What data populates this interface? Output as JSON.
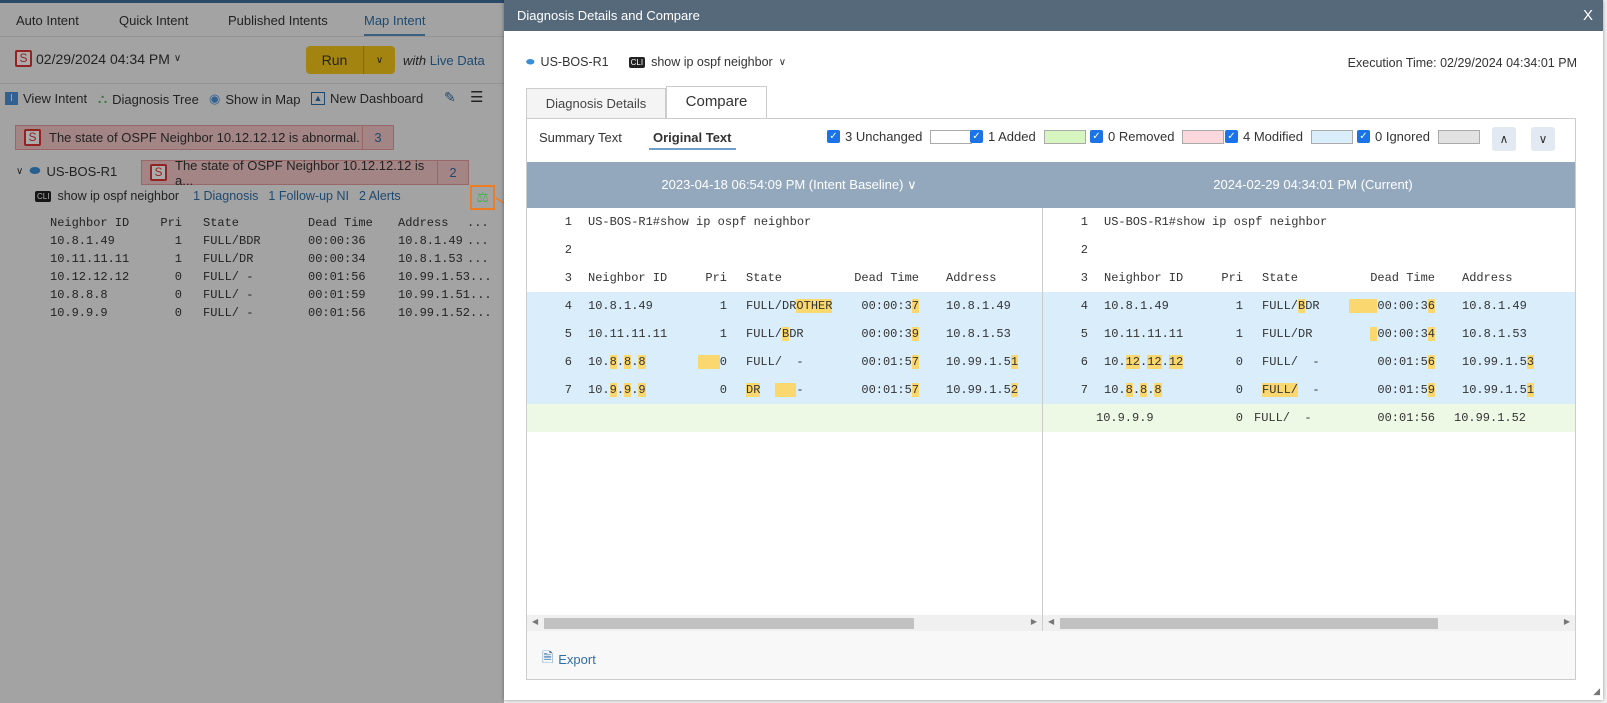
{
  "left_panel": {
    "tabs": [
      "Auto Intent",
      "Quick Intent",
      "Published Intents",
      "Map Intent"
    ],
    "active_tab": "Map Intent",
    "date": "02/29/2024 04:34 PM",
    "run_label": "Run",
    "with_label": "with",
    "live_data_label": "Live Data",
    "toolbar": [
      "View Intent",
      "Diagnosis Tree",
      "Show in Map",
      "New Dashboard"
    ],
    "alert_main": {
      "text": "The state of OSPF Neighbor 10.12.12.12 is abnormal.",
      "count": "3"
    },
    "device": "US-BOS-R1",
    "alert_device": {
      "text": "The state of OSPF Neighbor 10.12.12.12 is a...",
      "count": "2"
    },
    "cli_badge": "CLI",
    "command": "show ip ospf neighbor",
    "links": [
      "1 Diagnosis",
      "1 Follow-up NI",
      "2 Alerts"
    ],
    "table": {
      "headers": [
        "Neighbor ID",
        "Pri",
        "State",
        "Dead Time",
        "Address",
        "..."
      ],
      "rows": [
        [
          "10.8.1.49",
          "1",
          "FULL/BDR",
          "00:00:36",
          "10.8.1.49",
          "..."
        ],
        [
          "10.11.11.11",
          "1",
          "FULL/DR",
          "00:00:34",
          "10.8.1.53",
          "..."
        ],
        [
          "10.12.12.12",
          "0",
          "FULL/  -",
          "00:01:56",
          "10.99.1.53...",
          ""
        ],
        [
          "10.8.8.8",
          "0",
          "FULL/  -",
          "00:01:59",
          "10.99.1.51...",
          ""
        ],
        [
          "10.9.9.9",
          "0",
          "FULL/  -",
          "00:01:56",
          "10.99.1.52...",
          ""
        ]
      ]
    }
  },
  "modal": {
    "title": "Diagnosis Details and Compare",
    "close": "X",
    "device": "US-BOS-R1",
    "cli_badge": "CLI",
    "command": "show ip ospf neighbor",
    "execution_time": "Execution Time: 02/29/2024 04:34:01 PM",
    "tabs": [
      "Diagnosis Details",
      "Compare"
    ],
    "active_tab": "Compare",
    "view_modes": [
      "Summary Text",
      "Original Text"
    ],
    "active_view": "Original Text",
    "filters": [
      {
        "label": "3 Unchanged",
        "checked": true,
        "color": "#ffffff"
      },
      {
        "label": "1 Added",
        "checked": true,
        "color": "#d6f5c0"
      },
      {
        "label": "0 Removed",
        "checked": true,
        "color": "#fcd7dc"
      },
      {
        "label": "4 Modified",
        "checked": true,
        "color": "#d9edfb"
      },
      {
        "label": "0 Ignored",
        "checked": true,
        "color": "#e2e2e2"
      }
    ],
    "nav_up": "∧",
    "nav_down": "∨",
    "left_header": "2023-04-18 06:54:09 PM (Intent Baseline) ∨",
    "right_header": "2024-02-29 04:34:01 PM (Current)",
    "left_lines": [
      {
        "n": "1",
        "type": "unchanged",
        "cells": [
          [
            [
              "US-BOS-R1#show ip ospf neighbor",
              0
            ]
          ]
        ]
      },
      {
        "n": "2",
        "type": "unchanged",
        "cells": []
      },
      {
        "n": "3",
        "type": "unchanged",
        "cells": [
          [
            [
              "Neighbor ID",
              0
            ]
          ],
          [
            [
              "Pri",
              0
            ]
          ],
          [
            [
              "State",
              0
            ]
          ],
          [
            [
              "Dead Time",
              0
            ]
          ],
          [
            [
              "Address",
              0
            ]
          ]
        ]
      },
      {
        "n": "4",
        "type": "modified",
        "cells": [
          [
            [
              "10.8.1.49",
              0
            ]
          ],
          [
            [
              "1",
              0
            ]
          ],
          [
            [
              "FULL/DR",
              0
            ],
            [
              "OTHER",
              1
            ]
          ],
          [
            [
              "00:00:3",
              0
            ],
            [
              "7",
              1
            ]
          ],
          [
            [
              "10.8.1.49",
              0
            ]
          ]
        ]
      },
      {
        "n": "5",
        "type": "modified",
        "cells": [
          [
            [
              "10.11.11.11",
              0
            ]
          ],
          [
            [
              "1",
              0
            ]
          ],
          [
            [
              "FULL/",
              0
            ],
            [
              "B",
              1
            ],
            [
              "DR",
              0
            ]
          ],
          [
            [
              "00:00:3",
              0
            ],
            [
              "9",
              1
            ]
          ],
          [
            [
              "10.8.1.53",
              0
            ]
          ]
        ]
      },
      {
        "n": "6",
        "type": "modified",
        "cells": [
          [
            [
              "10.",
              0
            ],
            [
              "8",
              1
            ],
            [
              ".",
              0
            ],
            [
              "8",
              1
            ],
            [
              ".",
              0
            ],
            [
              "8",
              1
            ]
          ],
          [
            [
              "   ",
              1
            ],
            [
              "0",
              0
            ]
          ],
          [
            [
              "FULL/  -",
              0
            ]
          ],
          [
            [
              "00:01:5",
              0
            ],
            [
              "7",
              1
            ]
          ],
          [
            [
              "10.99.1.5",
              0
            ],
            [
              "1",
              1
            ]
          ]
        ]
      },
      {
        "n": "7",
        "type": "modified",
        "cells": [
          [
            [
              "10.",
              0
            ],
            [
              "9",
              1
            ],
            [
              ".",
              0
            ],
            [
              "9",
              1
            ],
            [
              ".",
              0
            ],
            [
              "9",
              1
            ]
          ],
          [
            [
              "0",
              0
            ]
          ],
          [
            [
              "DR",
              1
            ],
            [
              "  ",
              0
            ],
            [
              "   ",
              1
            ],
            [
              "-",
              0
            ]
          ],
          [
            [
              "00:01:5",
              0
            ],
            [
              "7",
              1
            ]
          ],
          [
            [
              "10.99.1.5",
              0
            ],
            [
              "2",
              1
            ]
          ]
        ]
      },
      {
        "n": "",
        "type": "added",
        "cells": []
      }
    ],
    "right_lines": [
      {
        "n": "1",
        "type": "unchanged",
        "cells": [
          [
            [
              "US-BOS-R1#show ip ospf neighbor",
              0
            ]
          ]
        ]
      },
      {
        "n": "2",
        "type": "unchanged",
        "cells": []
      },
      {
        "n": "3",
        "type": "unchanged",
        "cells": [
          [
            [
              "Neighbor ID",
              0
            ]
          ],
          [
            [
              "Pri",
              0
            ]
          ],
          [
            [
              "State",
              0
            ]
          ],
          [
            [
              "Dead Time",
              0
            ]
          ],
          [
            [
              "Address",
              0
            ]
          ]
        ]
      },
      {
        "n": "4",
        "type": "modified",
        "cells": [
          [
            [
              "10.8.1.49",
              0
            ]
          ],
          [
            [
              "1",
              0
            ]
          ],
          [
            [
              "FULL/",
              0
            ],
            [
              "B",
              1
            ],
            [
              "DR",
              0
            ]
          ],
          [
            [
              "    ",
              1
            ],
            [
              "00:00:3",
              0
            ],
            [
              "6",
              1
            ]
          ],
          [
            [
              "10.8.1.49",
              0
            ]
          ]
        ]
      },
      {
        "n": "5",
        "type": "modified",
        "cells": [
          [
            [
              "10.11.11.11",
              0
            ]
          ],
          [
            [
              "1",
              0
            ]
          ],
          [
            [
              "FULL/DR",
              0
            ]
          ],
          [
            [
              " ",
              1
            ],
            [
              "00:00:3",
              0
            ],
            [
              "4",
              1
            ]
          ],
          [
            [
              "10.8.1.53",
              0
            ]
          ]
        ]
      },
      {
        "n": "6",
        "type": "modified",
        "cells": [
          [
            [
              "10.",
              0
            ],
            [
              "12",
              1
            ],
            [
              ".",
              0
            ],
            [
              "12",
              1
            ],
            [
              ".",
              0
            ],
            [
              "12",
              1
            ]
          ],
          [
            [
              "0",
              0
            ]
          ],
          [
            [
              "FULL/  -",
              0
            ]
          ],
          [
            [
              "00:01:5",
              0
            ],
            [
              "6",
              1
            ]
          ],
          [
            [
              "10.99.1.5",
              0
            ],
            [
              "3",
              1
            ]
          ]
        ]
      },
      {
        "n": "7",
        "type": "modified",
        "cells": [
          [
            [
              "10.",
              0
            ],
            [
              "8",
              1
            ],
            [
              ".",
              0
            ],
            [
              "8",
              1
            ],
            [
              ".",
              0
            ],
            [
              "8",
              1
            ]
          ],
          [
            [
              "0",
              0
            ]
          ],
          [
            [
              "FULL/",
              1
            ],
            [
              "  -",
              0
            ]
          ],
          [
            [
              "00:01:5",
              0
            ],
            [
              "9",
              1
            ]
          ],
          [
            [
              "10.99.1.5",
              0
            ],
            [
              "1",
              1
            ]
          ]
        ]
      },
      {
        "n": "",
        "type": "added",
        "cells": [
          [
            [
              "10.9.9.9",
              0
            ]
          ],
          [
            [
              "0",
              0
            ]
          ],
          [
            [
              "FULL/  -",
              0
            ]
          ],
          [
            [
              "00:01:56",
              0
            ]
          ],
          [
            [
              "10.99.1.52",
              0
            ]
          ]
        ]
      }
    ],
    "export_label": "Export"
  }
}
